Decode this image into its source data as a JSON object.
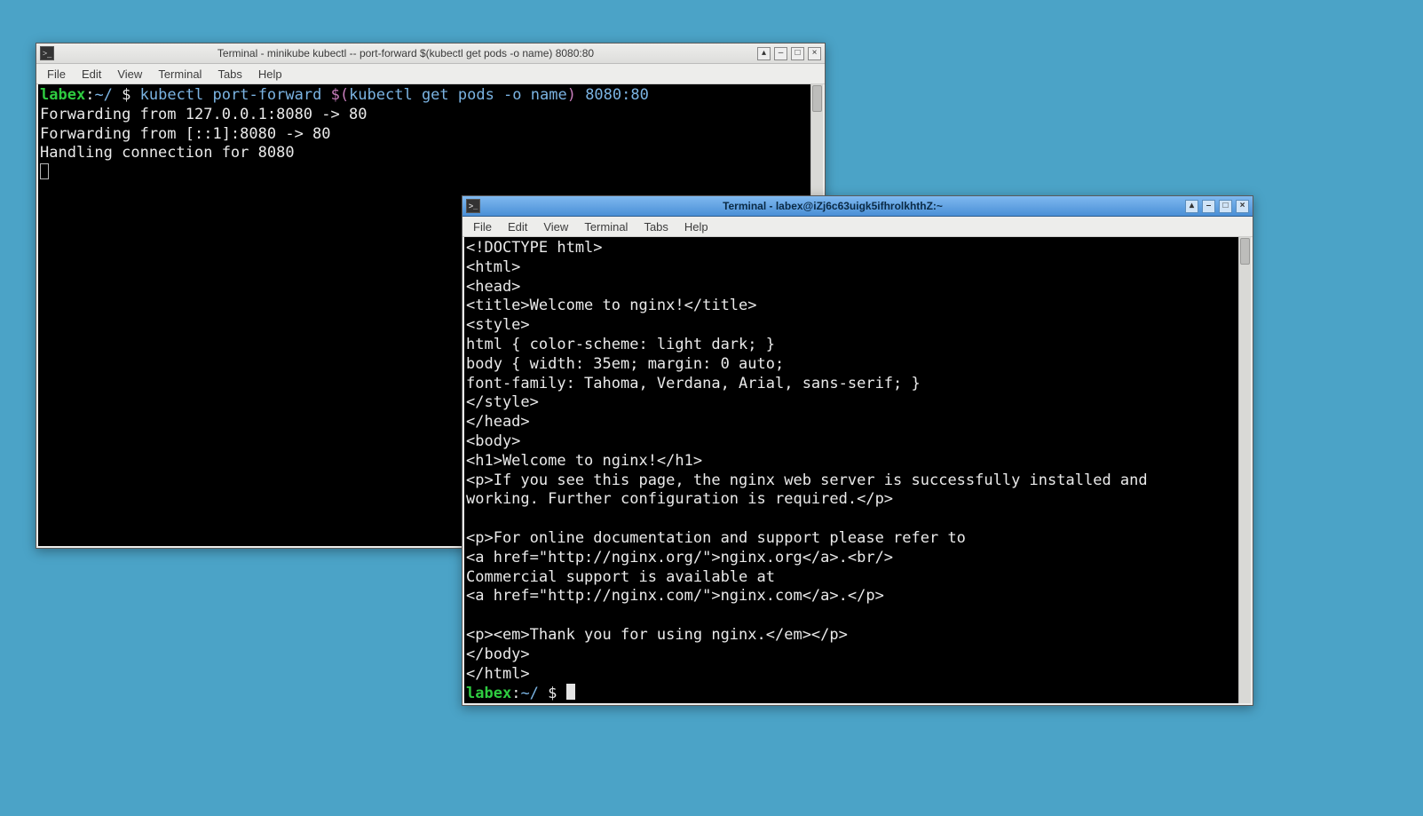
{
  "menus": {
    "file": "File",
    "edit": "Edit",
    "view": "View",
    "terminal": "Terminal",
    "tabs": "Tabs",
    "help": "Help"
  },
  "window_controls": {
    "shade": "▴",
    "minimize": "–",
    "maximize": "□",
    "close": "×"
  },
  "terminal1": {
    "title": "Terminal - minikube kubectl -- port-forward $(kubectl get pods -o name) 8080:80",
    "prompt_user": "labex",
    "prompt_cwd": "~/",
    "prompt_sep": ":",
    "prompt_dollar": " $ ",
    "cmd_part1": "kubectl port-forward ",
    "cmd_sub_open": "$(",
    "cmd_part2": "kubectl get pods -o name",
    "cmd_sub_close": ")",
    "cmd_part3": " 8080:80",
    "lines": [
      "Forwarding from 127.0.0.1:8080 -> 80",
      "Forwarding from [::1]:8080 -> 80",
      "Handling connection for 8080"
    ]
  },
  "terminal2": {
    "title": "Terminal - labex@iZj6c63uigk5ifhrolkhthZ:~",
    "prompt_user": "labex",
    "prompt_cwd": "~/",
    "prompt_sep": ":",
    "prompt_dollar": " $ ",
    "lines": [
      "<!DOCTYPE html>",
      "<html>",
      "<head>",
      "<title>Welcome to nginx!</title>",
      "<style>",
      "html { color-scheme: light dark; }",
      "body { width: 35em; margin: 0 auto;",
      "font-family: Tahoma, Verdana, Arial, sans-serif; }",
      "</style>",
      "</head>",
      "<body>",
      "<h1>Welcome to nginx!</h1>",
      "<p>If you see this page, the nginx web server is successfully installed and",
      "working. Further configuration is required.</p>",
      "",
      "<p>For online documentation and support please refer to",
      "<a href=\"http://nginx.org/\">nginx.org</a>.<br/>",
      "Commercial support is available at",
      "<a href=\"http://nginx.com/\">nginx.com</a>.</p>",
      "",
      "<p><em>Thank you for using nginx.</em></p>",
      "</body>",
      "</html>"
    ]
  }
}
